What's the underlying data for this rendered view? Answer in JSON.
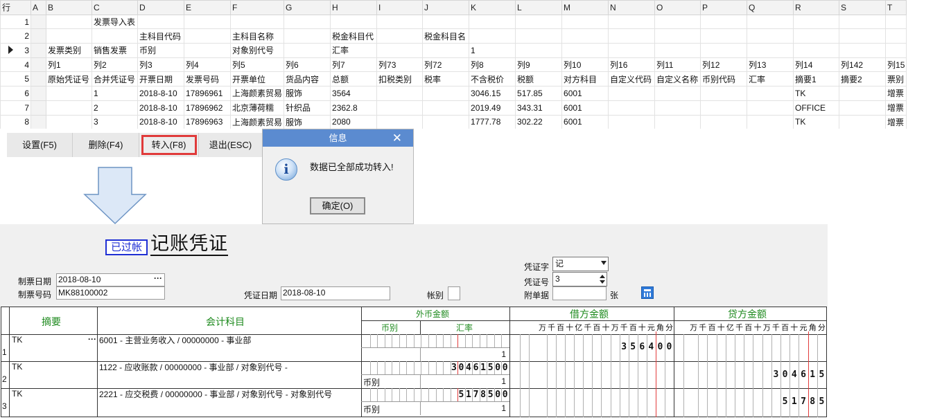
{
  "sheet": {
    "header": [
      "行",
      "A",
      "B",
      "C",
      "D",
      "E",
      "F",
      "G",
      "H",
      "I",
      "J",
      "K",
      "L",
      "M",
      "N",
      "O",
      "P",
      "Q",
      "R",
      "S",
      "T"
    ],
    "rows": [
      [
        "1",
        "",
        "",
        "发票导入表",
        "",
        "",
        "",
        "",
        "",
        "",
        "",
        "",
        "",
        "",
        "",
        "",
        "",
        "",
        "",
        "",
        ""
      ],
      [
        "2",
        "",
        "",
        "",
        "主科目代码",
        "",
        "主科目名称",
        "",
        "税金科目代",
        "",
        "税金科目名",
        "",
        "",
        "",
        "",
        "",
        "",
        "",
        "",
        "",
        ""
      ],
      [
        "3",
        "",
        "发票类别",
        "销售发票",
        "币别",
        "",
        "对象别代号",
        "",
        "汇率",
        "",
        "",
        "1",
        "",
        "",
        "",
        "",
        "",
        "",
        "",
        "",
        ""
      ],
      [
        "4",
        "",
        "列1",
        "列2",
        "列3",
        "列4",
        "列5",
        "列6",
        "列7",
        "列73",
        "列72",
        "列8",
        "列9",
        "列10",
        "列16",
        "列11",
        "列12",
        "列13",
        "列14",
        "列142",
        "列15"
      ],
      [
        "5",
        "",
        "原始凭证号",
        "合并凭证号",
        "开票日期",
        "发票号码",
        "开票单位",
        "货品内容",
        "总额",
        "扣税类别",
        "税率",
        "不含税价",
        "税额",
        "对方科目",
        "自定义代码",
        "自定义名称",
        "币别代码",
        "汇率",
        "摘要1",
        "摘要2",
        "票别"
      ],
      [
        "6",
        "",
        "",
        "1",
        "2018-8-10",
        "17896961",
        "上海颜素贸易",
        "服饰",
        "3564",
        "",
        "",
        "3046.15",
        "517.85",
        "6001",
        "",
        "",
        "",
        "",
        "TK",
        "",
        "增票"
      ],
      [
        "7",
        "",
        "",
        "2",
        "2018-8-10",
        "17896962",
        "北京薄荷糯",
        "针织品",
        "2362.8",
        "",
        "",
        "2019.49",
        "343.31",
        "6001",
        "",
        "",
        "",
        "",
        "OFFICE",
        "",
        "增票"
      ],
      [
        "8",
        "",
        "",
        "3",
        "2018-8-10",
        "17896963",
        "上海颜素贸易",
        "服饰",
        "2080",
        "",
        "",
        "1777.78",
        "302.22",
        "6001",
        "",
        "",
        "",
        "",
        "TK",
        "",
        "增票"
      ]
    ]
  },
  "toolbar": {
    "settings": "设置(F5)",
    "delete": "删除(F4)",
    "import": "转入(F8)",
    "exit": "退出(ESC)"
  },
  "dialog": {
    "title": "信息",
    "close": "✕",
    "message": "数据已全部成功转入!",
    "ok": "确定(O)"
  },
  "voucher": {
    "posted_badge": "已过帐",
    "title": "记账凭证",
    "make_date_label": "制票日期",
    "make_date": "2018-08-10",
    "ticket_no_label": "制票号码",
    "ticket_no": "MK88100002",
    "voucher_date_label": "凭证日期",
    "voucher_date": "2018-08-10",
    "account_label": "帐别",
    "word_label": "凭证字",
    "word": "记",
    "no_label": "凭证号",
    "no": "3",
    "attach_label": "附单据",
    "attach_unit": "张",
    "cols": {
      "summary": "摘要",
      "subject": "会计科目",
      "foreign": "外币金额",
      "currency": "币别",
      "rate": "汇率",
      "debit": "借方金额",
      "credit": "贷方金额",
      "digits": [
        "万",
        "千",
        "百",
        "十",
        "亿",
        "千",
        "百",
        "十",
        "万",
        "千",
        "百",
        "十",
        "元",
        "角",
        "分"
      ]
    },
    "lines": [
      {
        "n": "1",
        "summary": "TK",
        "subject": "6001 - 主营业务收入 / 00000000 - 事业部",
        "foreign": "",
        "currency": "",
        "rate": "1",
        "debit": "356400",
        "credit": ""
      },
      {
        "n": "2",
        "summary": "TK",
        "subject": "1122 - 应收账款 / 00000000 - 事业部 / 对象别代号 -",
        "foreign": "30461500",
        "currency": "币别",
        "rate": "1",
        "debit": "",
        "credit": "304615"
      },
      {
        "n": "3",
        "summary": "TK",
        "subject": "2221 - 应交税费 / 00000000 - 事业部 / 对象别代号 - 对象别代号",
        "foreign": "5178500",
        "currency": "币别",
        "rate": "1",
        "debit": "",
        "credit": "51785"
      }
    ]
  }
}
